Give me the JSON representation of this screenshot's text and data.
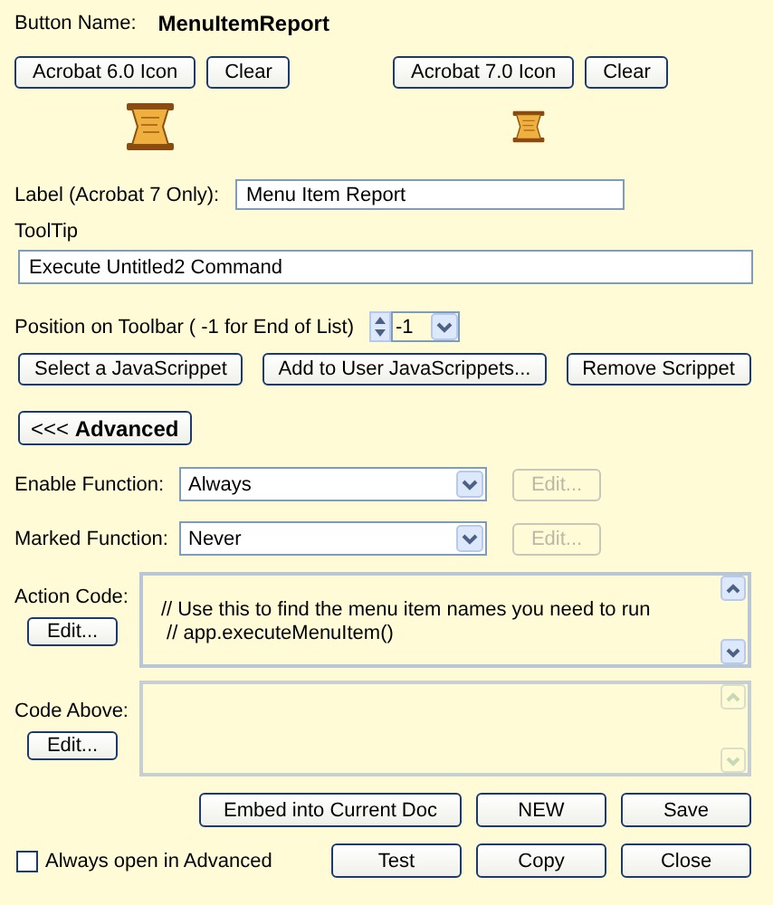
{
  "button_name": {
    "label": "Button Name:",
    "value": "MenuItemReport"
  },
  "icon_slots": [
    {
      "button": "Acrobat 6.0 Icon",
      "clear": "Clear",
      "kind": "large"
    },
    {
      "button": "Acrobat 7.0 Icon",
      "clear": "Clear",
      "kind": "small"
    }
  ],
  "label_field": {
    "label": "Label (Acrobat 7 Only):",
    "value": "Menu Item Report"
  },
  "tooltip": {
    "label": "ToolTip",
    "value": "Execute Untitled2 Command"
  },
  "position": {
    "label": "Position on Toolbar ( -1 for End of List)",
    "value": "-1"
  },
  "scrippet_buttons": [
    "Select a JavaScrippet",
    "Add to User JavaScrippets...",
    "Remove Scrippet"
  ],
  "advanced_button": "<<< **Advanced**",
  "functions": [
    {
      "label": "Enable Function:",
      "value": "Always",
      "edit": "Edit...",
      "edit_disabled": true
    },
    {
      "label": "Marked Function:",
      "value": "Never",
      "edit": "Edit...",
      "edit_disabled": true
    }
  ],
  "code_boxes": [
    {
      "label": "Action Code:",
      "edit": "Edit...",
      "lines": [
        "// Use this to find the menu item names you need to run",
        " // app.executeMenuItem()"
      ],
      "disabled": false
    },
    {
      "label": "Code Above:",
      "edit": "Edit...",
      "disabled": true
    }
  ],
  "action_buttons": [
    [
      "Embed into Current Doc",
      "NEW",
      "Save"
    ],
    [
      "Test",
      "Copy",
      "Close"
    ]
  ],
  "always_advanced": {
    "label": "Always open in Advanced",
    "checked": false
  }
}
